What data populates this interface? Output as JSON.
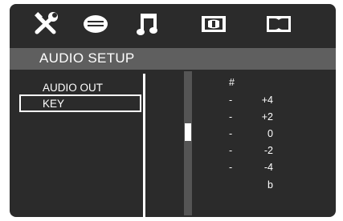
{
  "tabs": [
    {
      "name": "general-setup",
      "icon": "tools-icon"
    },
    {
      "name": "speaker-setup",
      "icon": "speech-bubble-icon"
    },
    {
      "name": "audio-setup",
      "icon": "music-note-icon",
      "active": true
    },
    {
      "name": "video-setup",
      "icon": "video-screen-icon"
    },
    {
      "name": "dolby-setup",
      "icon": "dolby-icon"
    }
  ],
  "title": "AUDIO SETUP",
  "menu": {
    "items": [
      {
        "label": "AUDIO OUT",
        "selected": false
      },
      {
        "label": "KEY",
        "selected": true
      }
    ]
  },
  "key_options": {
    "sharp": "#",
    "marks": [
      "-",
      "-",
      "-",
      "-",
      "-"
    ],
    "values": [
      "+4",
      "+2",
      "0",
      "-2",
      "-4"
    ],
    "flat": "b"
  },
  "slider": {
    "position_fraction": 0.41
  },
  "colors": {
    "background": "#2b2b2b",
    "title_bar": "#5f5f5f",
    "text": "#ffffff",
    "track": "#555555"
  }
}
